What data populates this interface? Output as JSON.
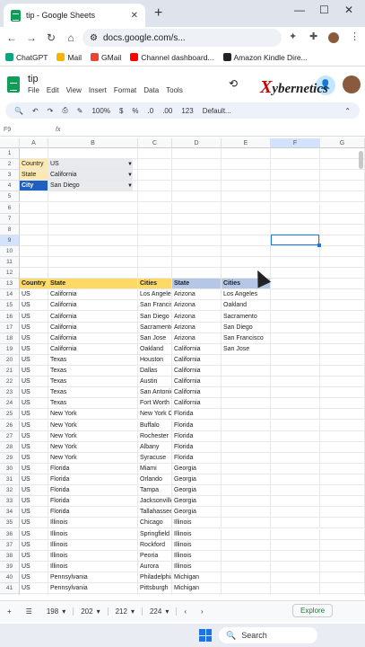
{
  "browser": {
    "tab_title": "tip - Google Sheets",
    "url": "docs.google.com/s..."
  },
  "bookmarks": [
    {
      "label": "ChatGPT",
      "color": "#10a37f"
    },
    {
      "label": "Mail",
      "color": "#f4b400"
    },
    {
      "label": "GMail",
      "color": "#ea4335"
    },
    {
      "label": "Channel dashboard...",
      "color": "#ff0000"
    },
    {
      "label": "Amazon Kindle Dire...",
      "color": "#222222"
    }
  ],
  "doc": {
    "title": "tip",
    "menu": [
      "File",
      "Edit",
      "View",
      "Insert",
      "Format",
      "Data",
      "Tools"
    ]
  },
  "brand": {
    "x": "X",
    "rest": "ybernetics"
  },
  "toolbar": {
    "zoom": "100%",
    "currency": "$",
    "percent": "%",
    "dec1": ".0",
    "dec2": ".00",
    "fmt": "123",
    "font": "Default..."
  },
  "formula": {
    "cell": "F9",
    "fx": "fx"
  },
  "columns": [
    "A",
    "B",
    "C",
    "D",
    "E",
    "F",
    "G"
  ],
  "dropdowns": [
    {
      "label": "Country",
      "value": "US"
    },
    {
      "label": "State",
      "value": "California"
    },
    {
      "label": "City",
      "value": "San Diego"
    }
  ],
  "header": {
    "country": "Country",
    "state": "State",
    "cities": "Cities",
    "state2": "State",
    "cities2": "Cities"
  },
  "rows": [
    [
      "US",
      "California",
      "Los Angeles",
      "Arizona",
      "Los Angeles"
    ],
    [
      "US",
      "California",
      "San Francisco",
      "Arizona",
      "Oakland"
    ],
    [
      "US",
      "California",
      "San Diego",
      "Arizona",
      "Sacramento"
    ],
    [
      "US",
      "California",
      "Sacramento",
      "Arizona",
      "San Diego"
    ],
    [
      "US",
      "California",
      "San Jose",
      "Arizona",
      "San Francisco"
    ],
    [
      "US",
      "California",
      "Oakland",
      "California",
      "San Jose"
    ],
    [
      "US",
      "Texas",
      "Houston",
      "California",
      ""
    ],
    [
      "US",
      "Texas",
      "Dallas",
      "California",
      ""
    ],
    [
      "US",
      "Texas",
      "Austin",
      "California",
      ""
    ],
    [
      "US",
      "Texas",
      "San Antonio",
      "California",
      ""
    ],
    [
      "US",
      "Texas",
      "Fort Worth",
      "California",
      ""
    ],
    [
      "US",
      "New York",
      "New York C",
      "Florida",
      ""
    ],
    [
      "US",
      "New York",
      "Buffalo",
      "Florida",
      ""
    ],
    [
      "US",
      "New York",
      "Rochester",
      "Florida",
      ""
    ],
    [
      "US",
      "New York",
      "Albany",
      "Florida",
      ""
    ],
    [
      "US",
      "New York",
      "Syracuse",
      "Florida",
      ""
    ],
    [
      "US",
      "Florida",
      "Miami",
      "Georgia",
      ""
    ],
    [
      "US",
      "Florida",
      "Orlando",
      "Georgia",
      ""
    ],
    [
      "US",
      "Florida",
      "Tampa",
      "Georgia",
      ""
    ],
    [
      "US",
      "Florida",
      "Jacksonville",
      "Georgia",
      ""
    ],
    [
      "US",
      "Florida",
      "Tallahassee",
      "Georgia",
      ""
    ],
    [
      "US",
      "Illinois",
      "Chicago",
      "Illinois",
      ""
    ],
    [
      "US",
      "Illinois",
      "Springfield",
      "Illinois",
      ""
    ],
    [
      "US",
      "Illinois",
      "Rockford",
      "Illinois",
      ""
    ],
    [
      "US",
      "Illinois",
      "Peoria",
      "Illinois",
      ""
    ],
    [
      "US",
      "Illinois",
      "Aurora",
      "Illinois",
      ""
    ],
    [
      "US",
      "Pennsylvania",
      "Philadelphia",
      "Michigan",
      ""
    ],
    [
      "US",
      "Pennsylvania",
      "Pittsburgh",
      "Michigan",
      ""
    ]
  ],
  "sheets": [
    "198",
    "202",
    "212",
    "224"
  ],
  "explore": "Explore",
  "taskbar": {
    "search": "Search"
  }
}
